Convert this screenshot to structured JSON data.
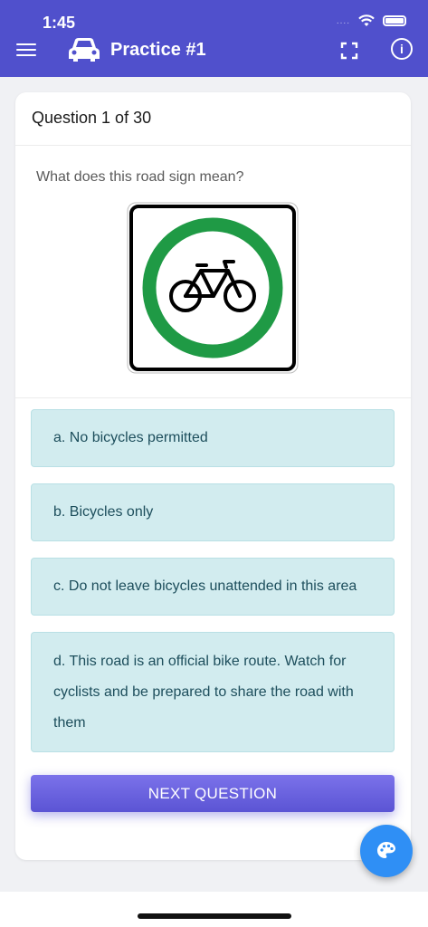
{
  "status_bar": {
    "time": "1:45",
    "signal": "....",
    "icons": [
      "wifi-icon",
      "battery-icon"
    ]
  },
  "header": {
    "title": "Practice #1",
    "icons": [
      "menu-icon",
      "car-icon",
      "expand-icon",
      "info-icon"
    ],
    "background": "#5050cc"
  },
  "card": {
    "title": "Question 1 of 30",
    "question": "What does this road sign mean?",
    "sign_icon": "bicycle-sign-icon"
  },
  "answers": [
    {
      "label": "a. No bicycles permitted"
    },
    {
      "label": "b. Bicycles only"
    },
    {
      "label": "c. Do not leave bicycles unattended in this area"
    },
    {
      "label": "d. This road is an official bike route. Watch for cyclists and be prepared to share the road with them"
    }
  ],
  "next_button": {
    "label": "NEXT QUESTION"
  },
  "fab": {
    "icon": "palette-icon",
    "color": "#2f8ff5"
  },
  "colors": {
    "answer_bg": "#d2ecef",
    "answer_text": "#1d4e5c",
    "button": "#5b54d4",
    "sign_green": "#1f9a45"
  }
}
